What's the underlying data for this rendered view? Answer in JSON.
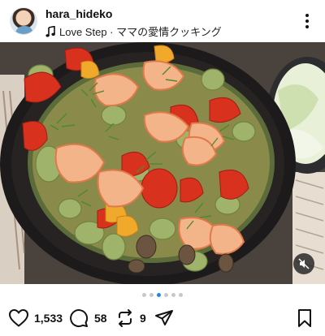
{
  "post": {
    "username": "hara_hideko",
    "music_label": "Love Step · ママの愛情クッキング"
  },
  "media": {
    "carousel_index": 3,
    "carousel_total": 6
  },
  "actions": {
    "likes": "1,533",
    "comments": "58",
    "reposts": "9"
  },
  "icons": [
    "music-note-icon",
    "more-options-icon",
    "mute-icon",
    "heart-icon",
    "comment-icon",
    "repost-icon",
    "share-icon",
    "bookmark-icon"
  ],
  "colors": {
    "active_dot": "#1e88e5",
    "inactive_dot": "#c8c8c8",
    "text": "#111111"
  }
}
